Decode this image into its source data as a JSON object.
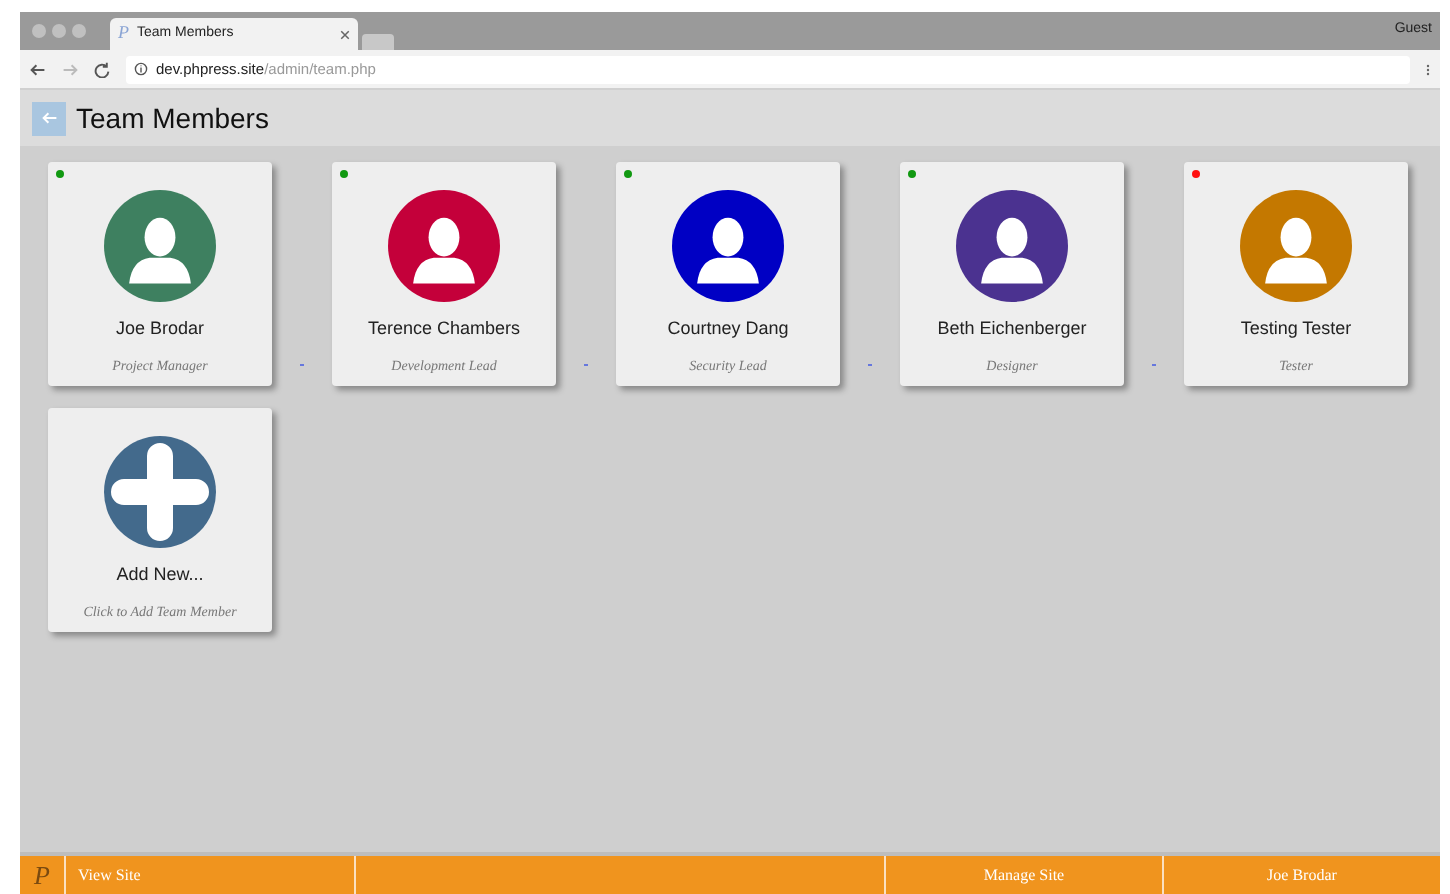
{
  "browser": {
    "tab_logo": "P",
    "tab_title": "Team Members",
    "profile": "Guest",
    "url_host": "dev.phpress.site",
    "url_path": "/admin/team.php"
  },
  "header": {
    "title": "Team Members"
  },
  "members": [
    {
      "name": "Joe Brodar",
      "role": "Project Manager",
      "color": "#3e8060",
      "online": true
    },
    {
      "name": "Terence Chambers",
      "role": "Development Lead",
      "color": "#c4003a",
      "online": true
    },
    {
      "name": "Courtney Dang",
      "role": "Security Lead",
      "color": "#0000c4",
      "online": true
    },
    {
      "name": "Beth Eichenberger",
      "role": "Designer",
      "color": "#4b3290",
      "online": true
    },
    {
      "name": "Testing Tester",
      "role": "Tester",
      "color": "#c47800",
      "online": false
    }
  ],
  "add_card": {
    "title": "Add New...",
    "subtitle": "Click to Add Team Member"
  },
  "footer": {
    "logo": "P",
    "left_items": [
      "View Site"
    ],
    "right_items": [
      "Manage Site",
      "Joe Brodar"
    ]
  }
}
